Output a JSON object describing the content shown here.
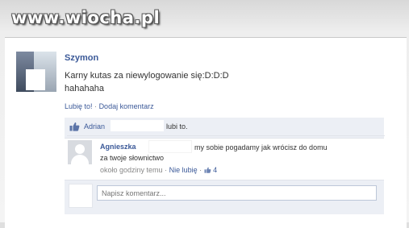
{
  "watermark": "www.wiocha.pl",
  "post": {
    "author": "Szymon",
    "lines": [
      "Karny kutas za niewylogowanie się:D:D:D",
      "hahahaha"
    ],
    "like_link": "Lubię to!",
    "separator": "·",
    "comment_link": "Dodaj komentarz"
  },
  "likes": {
    "name": "Adrian",
    "text": "lubi to."
  },
  "comment": {
    "author": "Agnieszka",
    "text_line1": "my sobie pogadamy jak wrócisz do domu",
    "text_line2": "za twoje słownictwo",
    "time": "około godziny temu",
    "separator": "·",
    "unlike": "Nie lubię",
    "like_count": "4"
  },
  "input": {
    "placeholder": "Napisz komentarz..."
  },
  "colors": {
    "link": "#3b5998",
    "ufi_bg": "#eceff5"
  },
  "icons": [
    "thumbs-up-icon",
    "default-avatar-icon"
  ]
}
